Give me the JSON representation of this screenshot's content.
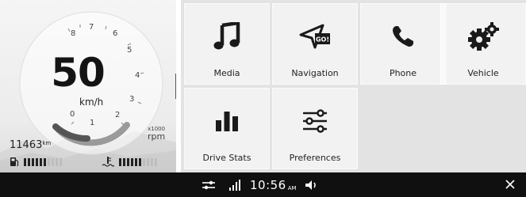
{
  "dashboard": {
    "speed": "50",
    "speed_unit": "km/h",
    "odometer_value": "11463",
    "odometer_unit": "km",
    "rpm_scale": "x1000",
    "rpm_unit": "rpm",
    "gauge_ticks": [
      "0",
      "1",
      "2",
      "3",
      "4",
      "5",
      "6",
      "7",
      "8"
    ],
    "fuel_level": 0.55,
    "coolant_level": 0.6
  },
  "tiles": [
    {
      "label": "Media",
      "icon": "music-note-icon"
    },
    {
      "label": "Navigation",
      "icon": "navigation-arrow-icon",
      "badge": "GO!"
    },
    {
      "label": "Phone",
      "icon": "phone-icon"
    },
    {
      "label": "Vehicle",
      "icon": "gears-icon"
    },
    {
      "label": "Drive Stats",
      "icon": "bar-chart-icon"
    },
    {
      "label": "Preferences",
      "icon": "sliders-icon"
    }
  ],
  "status_bar": {
    "time": "10:56",
    "ampm": "AM",
    "icons": [
      "settings-sliders-icon",
      "signal-icon",
      "volume-icon",
      "close-icon"
    ]
  }
}
